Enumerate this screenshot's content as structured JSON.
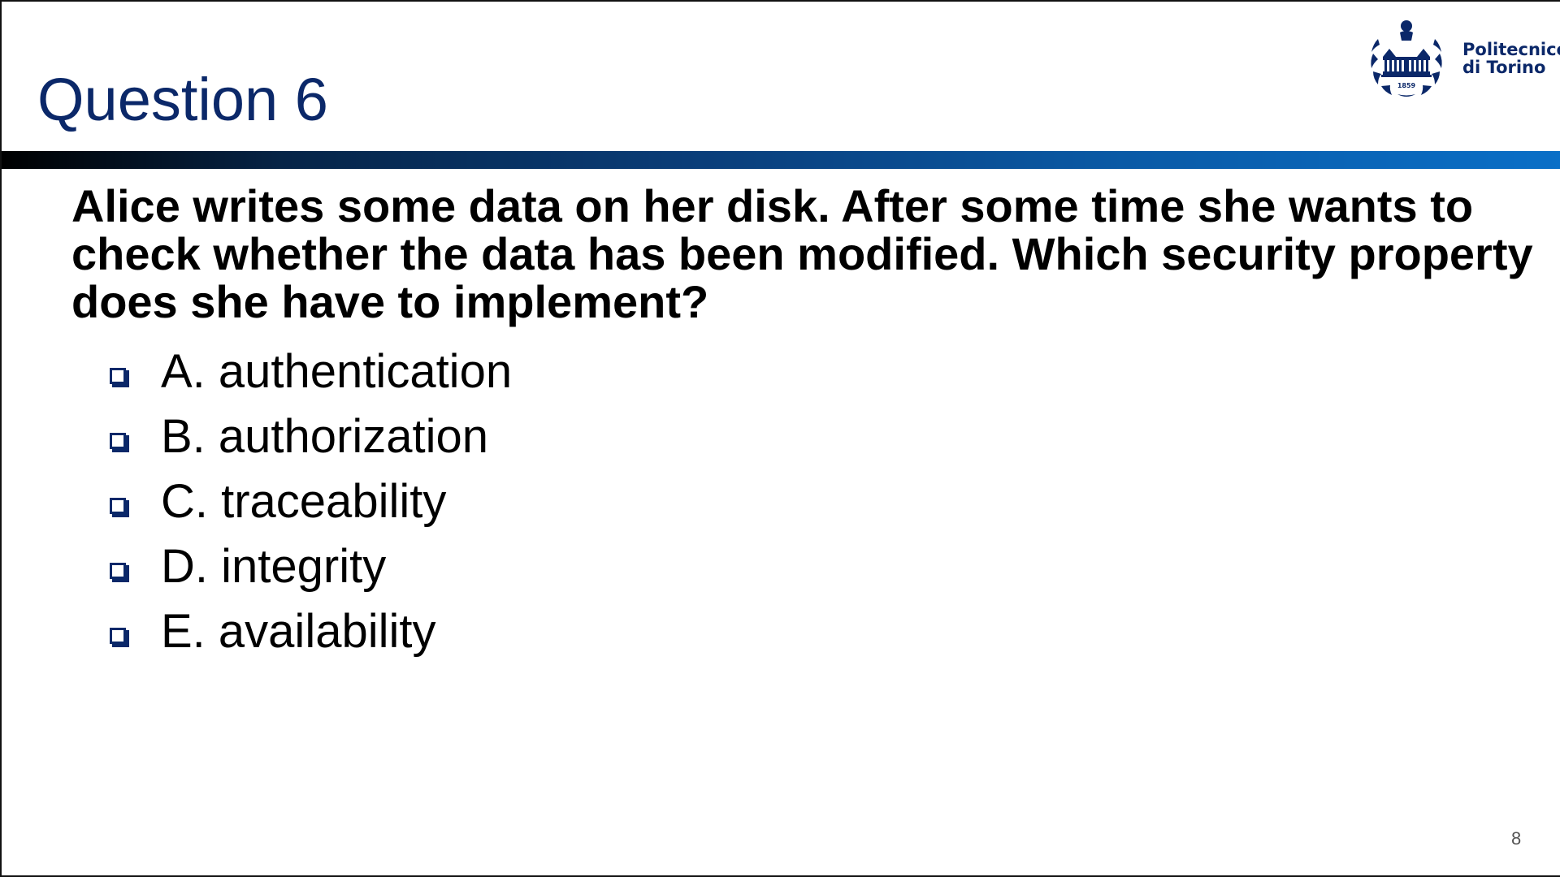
{
  "slide": {
    "title": "Question 6",
    "question": "Alice writes some data on her disk. After some time she wants to check whether the data has been modified. Which security property does she have to implement?",
    "options": [
      {
        "label": "A. authentication"
      },
      {
        "label": "B. authorization"
      },
      {
        "label": "C. traceability"
      },
      {
        "label": "D. integrity"
      },
      {
        "label": "E. availability"
      }
    ],
    "page_number": "8"
  },
  "logo": {
    "line1": "Politecnico",
    "line2": "di Torino",
    "year": "1859",
    "icon": "politecnico-seal-icon"
  },
  "colors": {
    "title": "#0b2869",
    "accent_bar_start": "#000000",
    "accent_bar_end": "#0a6fc7",
    "checkbox": "#0b2869"
  }
}
